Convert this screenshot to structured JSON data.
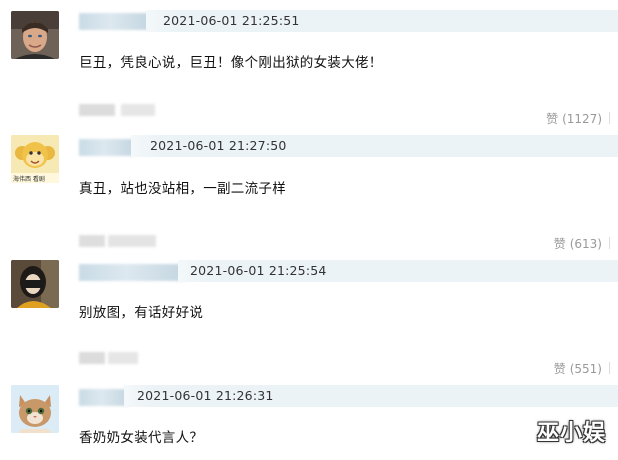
{
  "comments": [
    {
      "timestamp": "2021-06-01 21:25:51",
      "text": "巨丑，凭良心说，巨丑！像个刚出狱的女装大佬！",
      "likes_label": "赞",
      "likes_count": "(1127)"
    },
    {
      "timestamp": "2021-06-01 21:27:50",
      "text": "真丑，站也没站相，一副二流子样",
      "likes_label": "赞",
      "likes_count": "(613)",
      "avatar_caption": "海伟西 看剧"
    },
    {
      "timestamp": "2021-06-01 21:25:54",
      "text": "别放图，有话好好说",
      "likes_label": "赞",
      "likes_count": "(551)"
    },
    {
      "timestamp": "2021-06-01 21:26:31",
      "text": "香奶奶女装代言人？"
    }
  ],
  "watermark": "巫小娱"
}
